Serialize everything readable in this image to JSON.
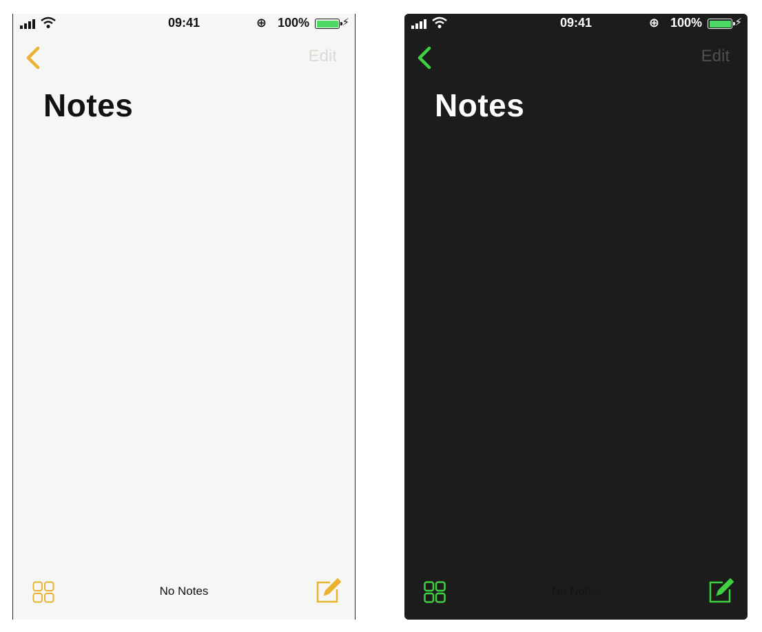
{
  "light": {
    "status_bar": {
      "time": "09:41",
      "battery_percent": "100%",
      "lock_icon": "⊕"
    },
    "nav": {
      "back_icon": "chevron-left-icon",
      "edit_label": "Edit"
    },
    "title": "Notes",
    "toolbar": {
      "status": "No Notes",
      "left_icon": "gallery-grid-icon",
      "right_icon": "compose-icon"
    },
    "colors": {
      "accent": "#e9b32f",
      "background": "#f6f6f4",
      "edit_disabled": "#d9d9d6"
    }
  },
  "dark": {
    "status_bar": {
      "time": "09:41",
      "battery_percent": "100%",
      "lock_icon": "⊕"
    },
    "nav": {
      "back_icon": "chevron-left-icon",
      "edit_label": "Edit"
    },
    "title": "Notes",
    "toolbar": {
      "status": "No Notes",
      "left_icon": "gallery-grid-icon",
      "right_icon": "compose-icon"
    },
    "colors": {
      "accent": "#3fd13f",
      "background": "#1c1c1d",
      "edit_disabled": "#505052"
    }
  }
}
